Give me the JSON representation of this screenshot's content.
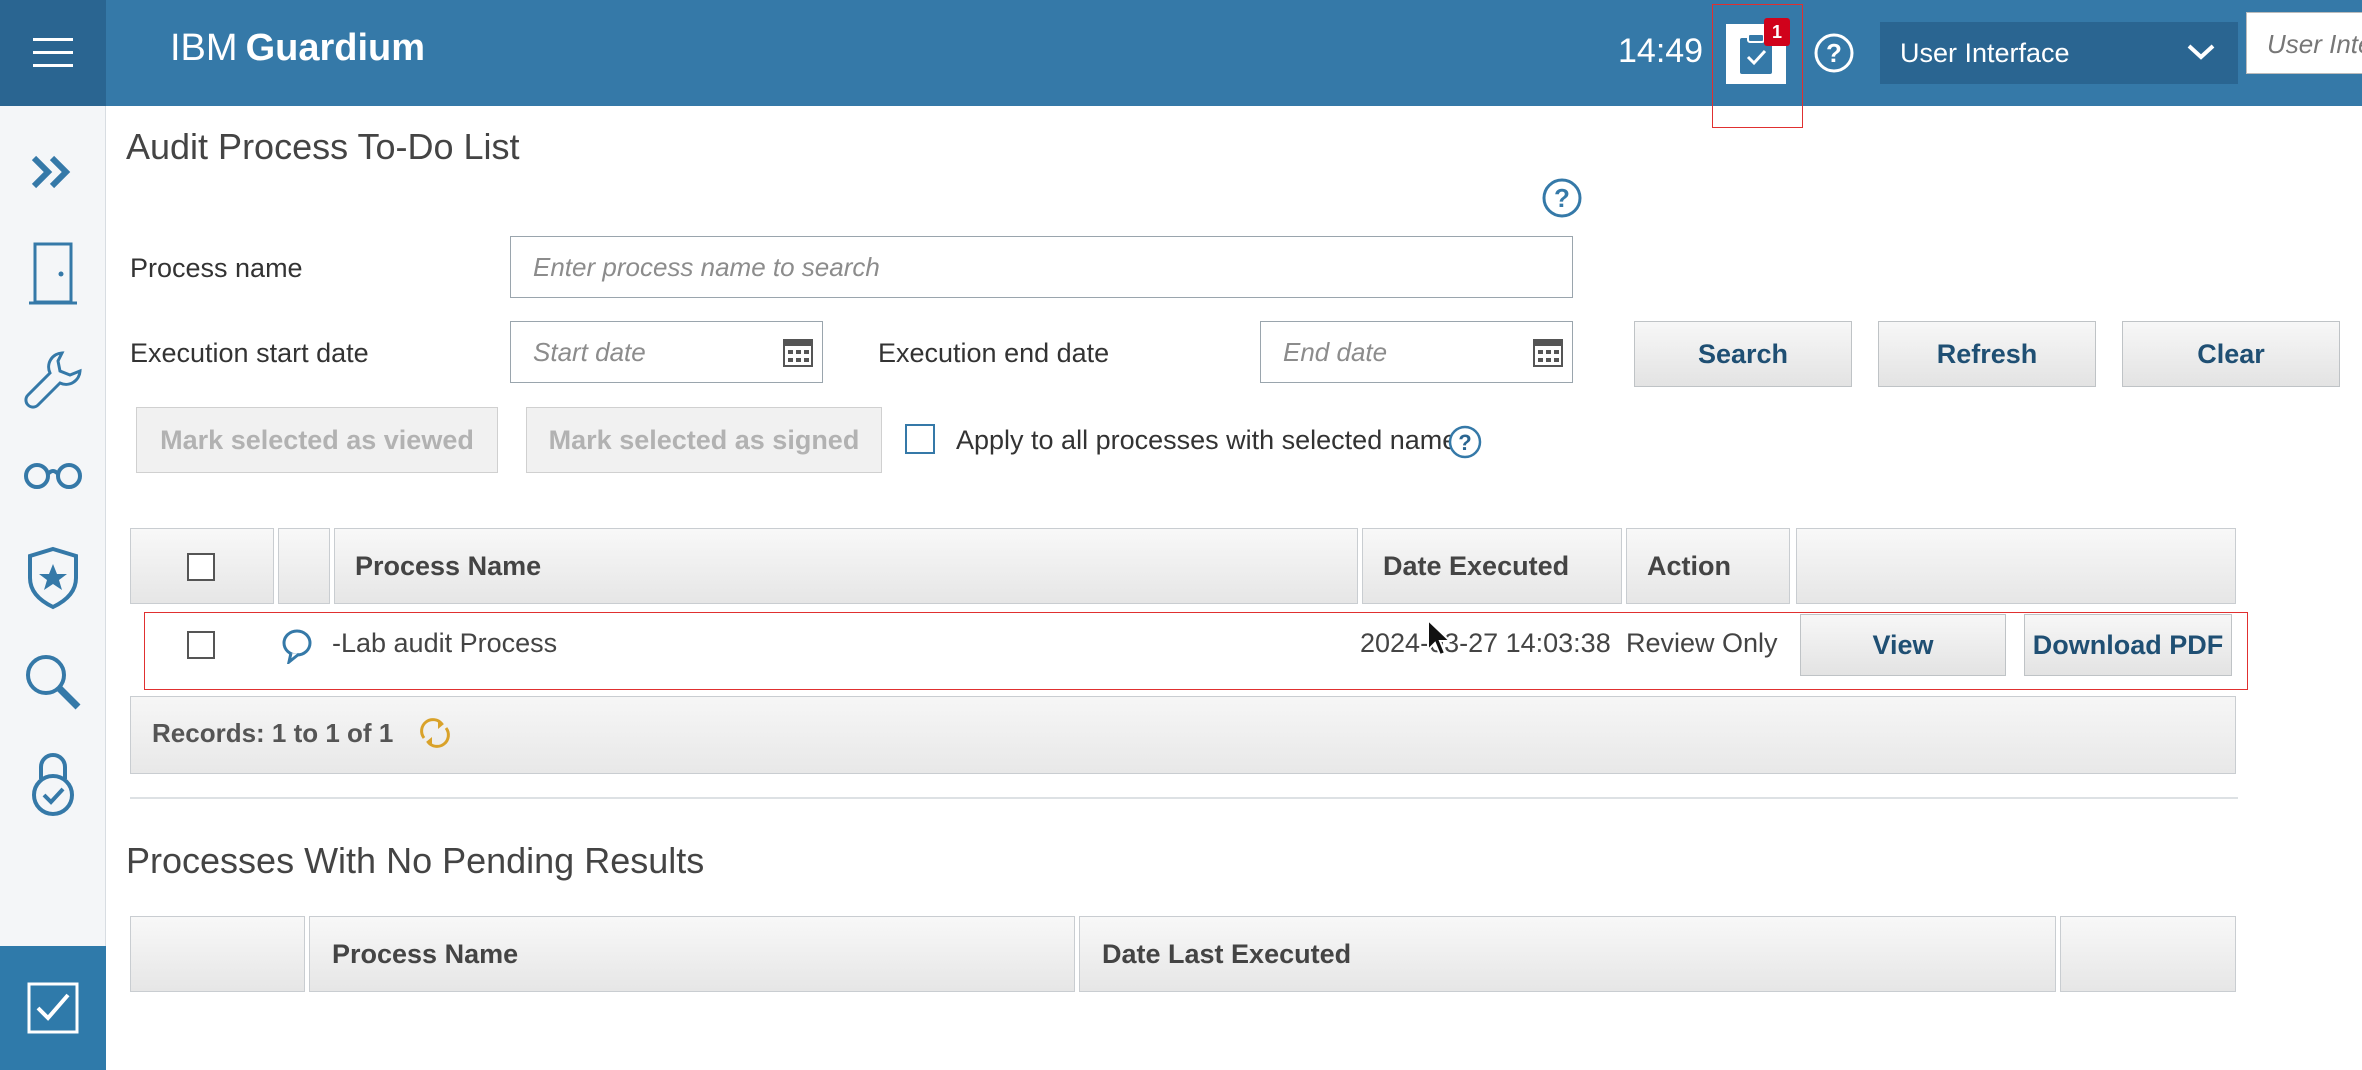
{
  "header": {
    "brand_prefix": "IBM",
    "brand_name": "Guardium",
    "time": "14:49",
    "todo_badge": "1",
    "ui_select": "User Interface",
    "ui_search_placeholder": "User Inte"
  },
  "sidebar": {
    "items": [
      {
        "icon": "expand-icon"
      },
      {
        "icon": "door-icon"
      },
      {
        "icon": "wrench-icon"
      },
      {
        "icon": "glasses-icon"
      },
      {
        "icon": "shield-star-icon"
      },
      {
        "icon": "search-icon"
      },
      {
        "icon": "lock-check-icon"
      },
      {
        "icon": "checklist-icon",
        "active": true
      }
    ]
  },
  "main": {
    "title": "Audit Process To-Do List",
    "filters": {
      "process_name_label": "Process name",
      "process_name_placeholder": "Enter process name to search",
      "start_label": "Execution start date",
      "start_placeholder": "Start date",
      "end_label": "Execution end date",
      "end_placeholder": "End date"
    },
    "buttons": {
      "search": "Search",
      "refresh": "Refresh",
      "clear": "Clear",
      "mark_viewed": "Mark selected as viewed",
      "mark_signed": "Mark selected as signed"
    },
    "apply_all_label": "Apply to all processes with selected name",
    "table": {
      "headers": [
        "Process Name",
        "Date Executed",
        "Action"
      ],
      "rows": [
        {
          "name": "-Lab audit Process",
          "date": "2024-03-27 14:03:38",
          "action": "Review Only",
          "view": "View",
          "download": "Download PDF"
        }
      ],
      "records": "Records: 1 to 1 of 1"
    },
    "no_pending": {
      "title": "Processes With No Pending Results",
      "headers": [
        "Process Name",
        "Date Last Executed"
      ]
    }
  },
  "colors": {
    "header_bg": "#3579a8",
    "accent": "#2f7aaa",
    "badge": "#d0021b"
  }
}
